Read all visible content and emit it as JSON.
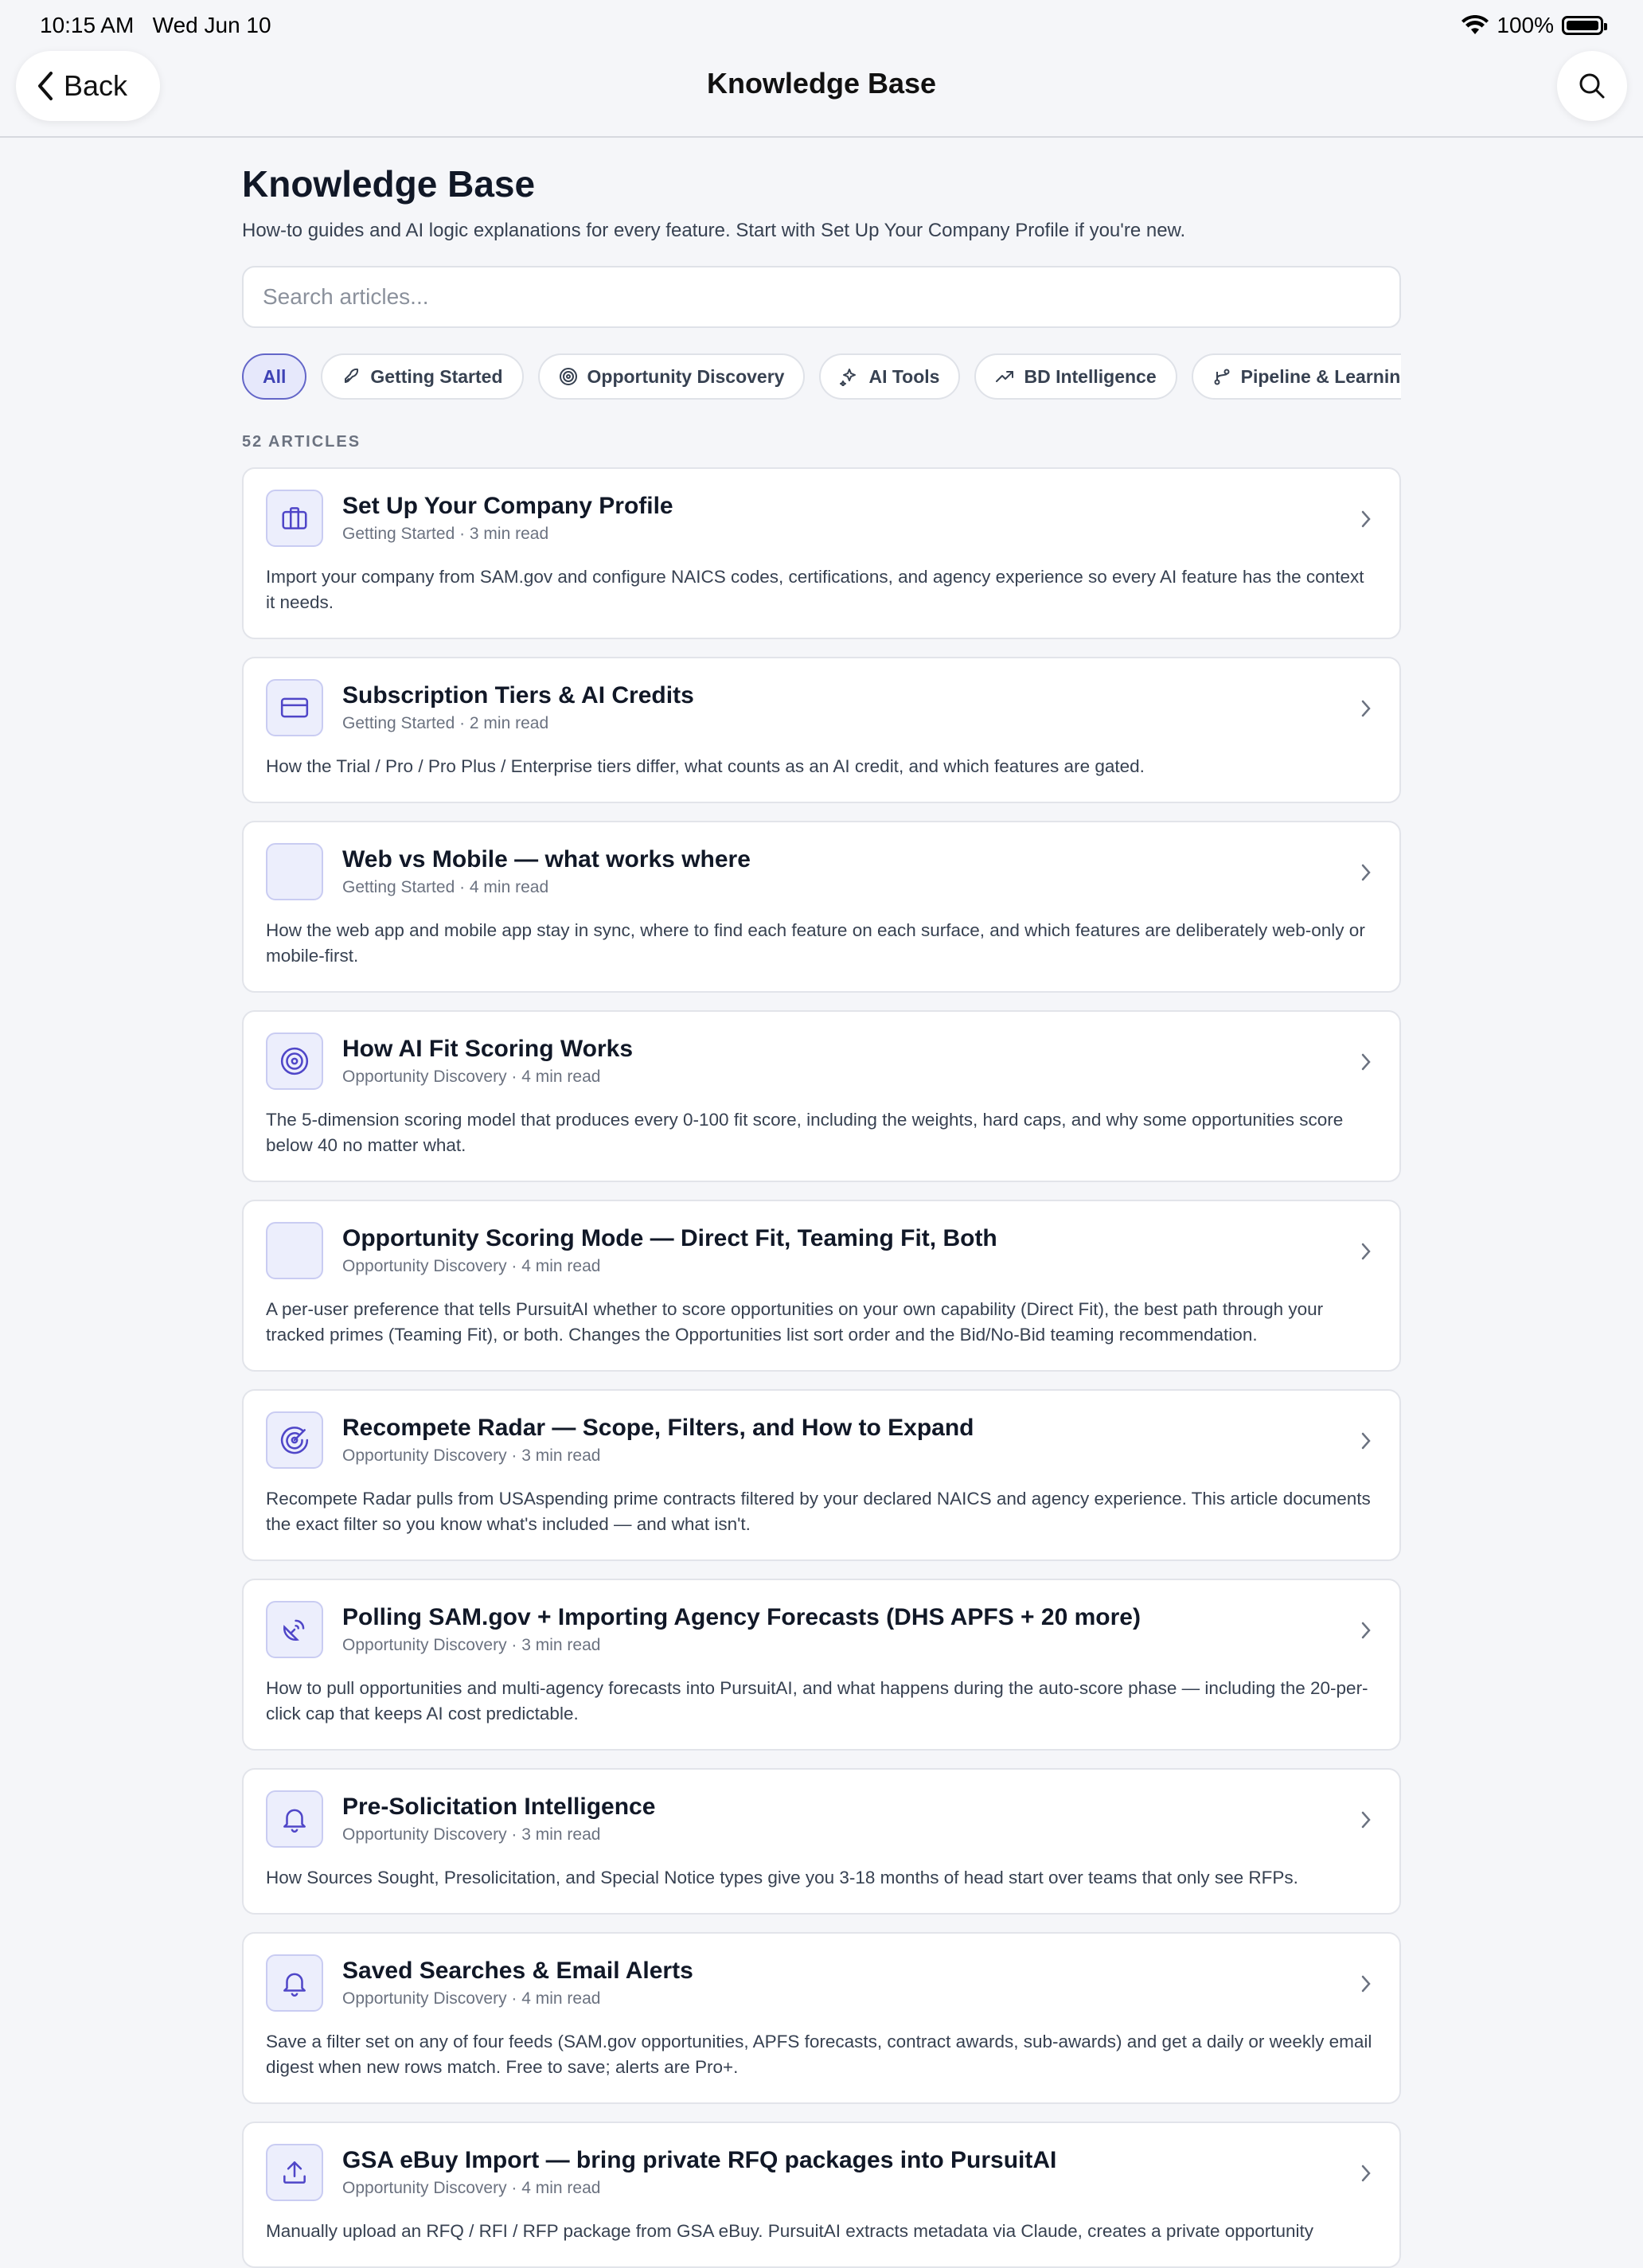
{
  "status": {
    "time": "10:15 AM",
    "date": "Wed Jun 10",
    "battery": "100%"
  },
  "nav": {
    "back_label": "Back",
    "title": "Knowledge Base"
  },
  "header": {
    "title": "Knowledge Base",
    "subtitle": "How-to guides and AI logic explanations for every feature. Start with Set Up Your Company Profile if you're new."
  },
  "search": {
    "placeholder": "Search articles..."
  },
  "filters": [
    {
      "label": "All",
      "icon": ""
    },
    {
      "label": "Getting Started",
      "icon": "rocket-icon"
    },
    {
      "label": "Opportunity Discovery",
      "icon": "target-icon"
    },
    {
      "label": "AI Tools",
      "icon": "sparkles-icon"
    },
    {
      "label": "BD Intelligence",
      "icon": "trending-up-icon"
    },
    {
      "label": "Pipeline & Learning",
      "icon": "git-branch-icon"
    }
  ],
  "article_count": "52 ARTICLES",
  "articles": [
    {
      "title": "Set Up Your Company Profile",
      "meta": "Getting Started · 3 min read",
      "icon": "briefcase-icon",
      "desc": "Import your company from SAM.gov and configure NAICS codes, certifications, and agency experience so every AI feature has the context it needs."
    },
    {
      "title": "Subscription Tiers & AI Credits",
      "meta": "Getting Started · 2 min read",
      "icon": "credit-card-icon",
      "desc": "How the Trial / Pro / Pro Plus / Enterprise tiers differ, what counts as an AI credit, and which features are gated."
    },
    {
      "title": "Web vs Mobile — what works where",
      "meta": "Getting Started · 4 min read",
      "icon": "",
      "desc": "How the web app and mobile app stay in sync, where to find each feature on each surface, and which features are deliberately web-only or mobile-first."
    },
    {
      "title": "How AI Fit Scoring Works",
      "meta": "Opportunity Discovery · 4 min read",
      "icon": "target-icon",
      "desc": "The 5-dimension scoring model that produces every 0-100 fit score, including the weights, hard caps, and why some opportunities score below 40 no matter what."
    },
    {
      "title": "Opportunity Scoring Mode — Direct Fit, Teaming Fit, Both",
      "meta": "Opportunity Discovery · 4 min read",
      "icon": "",
      "desc": "A per-user preference that tells PursuitAI whether to score opportunities on your own capability (Direct Fit), the best path through your tracked primes (Teaming Fit), or both. Changes the Opportunities list sort order and the Bid/No-Bid teaming recommendation."
    },
    {
      "title": "Recompete Radar — Scope, Filters, and How to Expand",
      "meta": "Opportunity Discovery · 3 min read",
      "icon": "radar-icon",
      "desc": "Recompete Radar pulls from USAspending prime contracts filtered by your declared NAICS and agency experience. This article documents the exact filter so you know what's included — and what isn't."
    },
    {
      "title": "Polling SAM.gov + Importing Agency Forecasts (DHS APFS + 20 more)",
      "meta": "Opportunity Discovery · 3 min read",
      "icon": "satellite-dish-icon",
      "desc": "How to pull opportunities and multi-agency forecasts into PursuitAI, and what happens during the auto-score phase — including the 20-per-click cap that keeps AI cost predictable."
    },
    {
      "title": "Pre-Solicitation Intelligence",
      "meta": "Opportunity Discovery · 3 min read",
      "icon": "bell-icon",
      "desc": "How Sources Sought, Presolicitation, and Special Notice types give you 3-18 months of head start over teams that only see RFPs."
    },
    {
      "title": "Saved Searches & Email Alerts",
      "meta": "Opportunity Discovery · 4 min read",
      "icon": "bell-icon",
      "desc": "Save a filter set on any of four feeds (SAM.gov opportunities, APFS forecasts, contract awards, sub-awards) and get a daily or weekly email digest when new rows match. Free to save; alerts are Pro+."
    },
    {
      "title": "GSA eBuy Import — bring private RFQ packages into PursuitAI",
      "meta": "Opportunity Discovery · 4 min read",
      "icon": "upload-icon",
      "desc": "Manually upload an RFQ / RFI / RFP package from GSA eBuy. PursuitAI extracts metadata via Claude, creates a private opportunity"
    }
  ],
  "colors": {
    "accent": "#4f46c8",
    "chip_active_bg": "#e6e8fb",
    "icon_bg": "#eceefc"
  }
}
